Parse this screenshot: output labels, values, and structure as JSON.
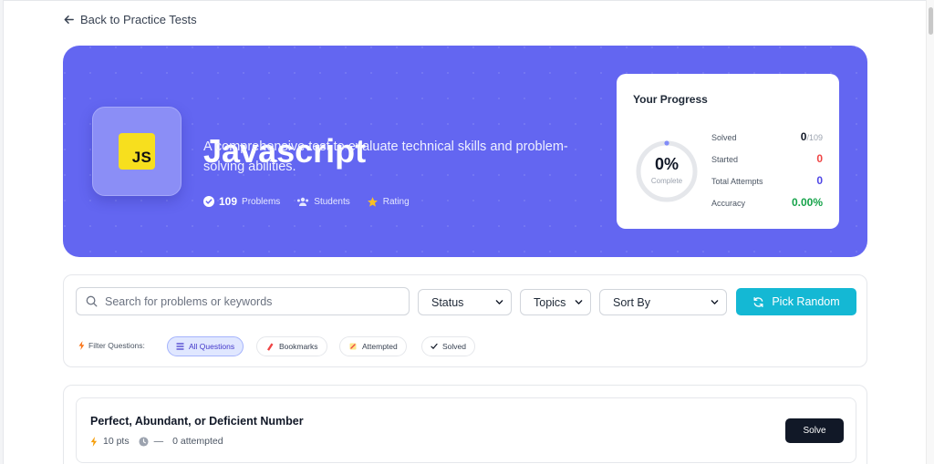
{
  "nav": {
    "back_label": "Back to Practice Tests"
  },
  "hero": {
    "logo_text": "JS",
    "title": "Javascript",
    "description": "A comprehensive test to evaluate technical skills and problem-solving abilities.",
    "problems_count": "109",
    "problems_label": "Problems",
    "students_label": "Students",
    "rating_label": "Rating",
    "accent_color": "#6366f1"
  },
  "progress": {
    "title": "Your Progress",
    "percent_text": "0%",
    "percent_label": "Complete",
    "percent_value": 0,
    "stats": {
      "solved_label": "Solved",
      "solved_value": "0",
      "solved_total": "/109",
      "started_label": "Started",
      "started_value": "0",
      "attempts_label": "Total Attempts",
      "attempts_value": "0",
      "accuracy_label": "Accuracy",
      "accuracy_value": "0.00%"
    },
    "colors": {
      "started": "#ef4444",
      "attempts": "#4f46e5",
      "accuracy": "#16a34a"
    }
  },
  "filters": {
    "search_placeholder": "Search for problems or keywords",
    "status_label": "Status",
    "topics_label": "Topics",
    "sort_label": "Sort By",
    "pick_random_label": "Pick Random",
    "filter_questions_label": "Filter Questions:",
    "chips": {
      "all": "All Questions",
      "bookmarks": "Bookmarks",
      "attempted": "Attempted",
      "solved": "Solved"
    }
  },
  "problems": [
    {
      "title": "Perfect, Abundant, or Deficient Number",
      "points": "10 pts",
      "time": "—",
      "attempted": "0 attempted",
      "action": "Solve"
    }
  ]
}
